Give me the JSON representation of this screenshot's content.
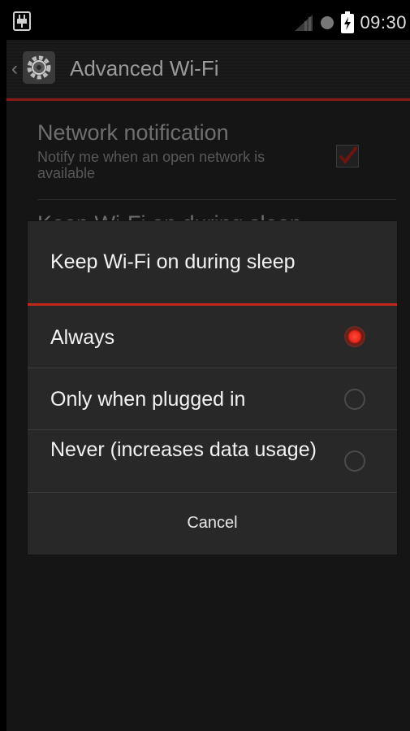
{
  "status_bar": {
    "time": "09:30",
    "usb_icon": "usb-debug-icon",
    "signal_icon": "signal-icon",
    "sync_icon": "circle-icon",
    "battery_icon": "battery-charging-icon"
  },
  "action_bar": {
    "title": "Advanced Wi-Fi",
    "up_icon": "chevron-left-icon",
    "app_icon": "settings-gear-icon"
  },
  "settings": [
    {
      "title": "Network notification",
      "summary": "Notify me when an open network is available",
      "checked": true
    },
    {
      "title": "Keep Wi-Fi on during sleep"
    }
  ],
  "dialog": {
    "title": "Keep Wi-Fi on during sleep",
    "options": [
      {
        "label": "Always",
        "selected": true
      },
      {
        "label": "Only when plugged in",
        "selected": false
      },
      {
        "label": "Never (increases data usage)",
        "selected": false
      }
    ],
    "cancel_label": "Cancel"
  },
  "colors": {
    "accent": "#e8261a",
    "title_line": "#c2271b"
  }
}
